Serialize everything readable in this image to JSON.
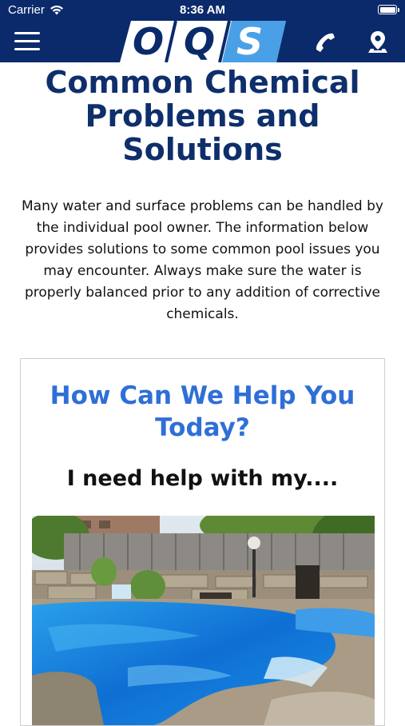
{
  "status_bar": {
    "carrier": "Carrier",
    "time": "8:36 AM"
  },
  "header": {
    "logo_letters": [
      "O",
      "Q",
      "S"
    ],
    "brand_color": "#0b2a6b",
    "logo_accent": "#4aa0e6",
    "icons": [
      "menu-icon",
      "phone-icon",
      "location-pin-icon"
    ]
  },
  "main": {
    "title": "Common Chemical Problems and Solutions",
    "intro": "Many water and surface problems can be handled by the individual pool owner. The information below provides solutions to some common pool issues you may encounter. Always make sure the water is properly balanced prior to any addition of corrective chemicals.",
    "title_color": "#0e2f6b"
  },
  "card": {
    "title": "How Can We Help You Today?",
    "subtitle": "I need help with my....",
    "title_color": "#2f6fd6",
    "image": "swimming-pool-photo"
  }
}
